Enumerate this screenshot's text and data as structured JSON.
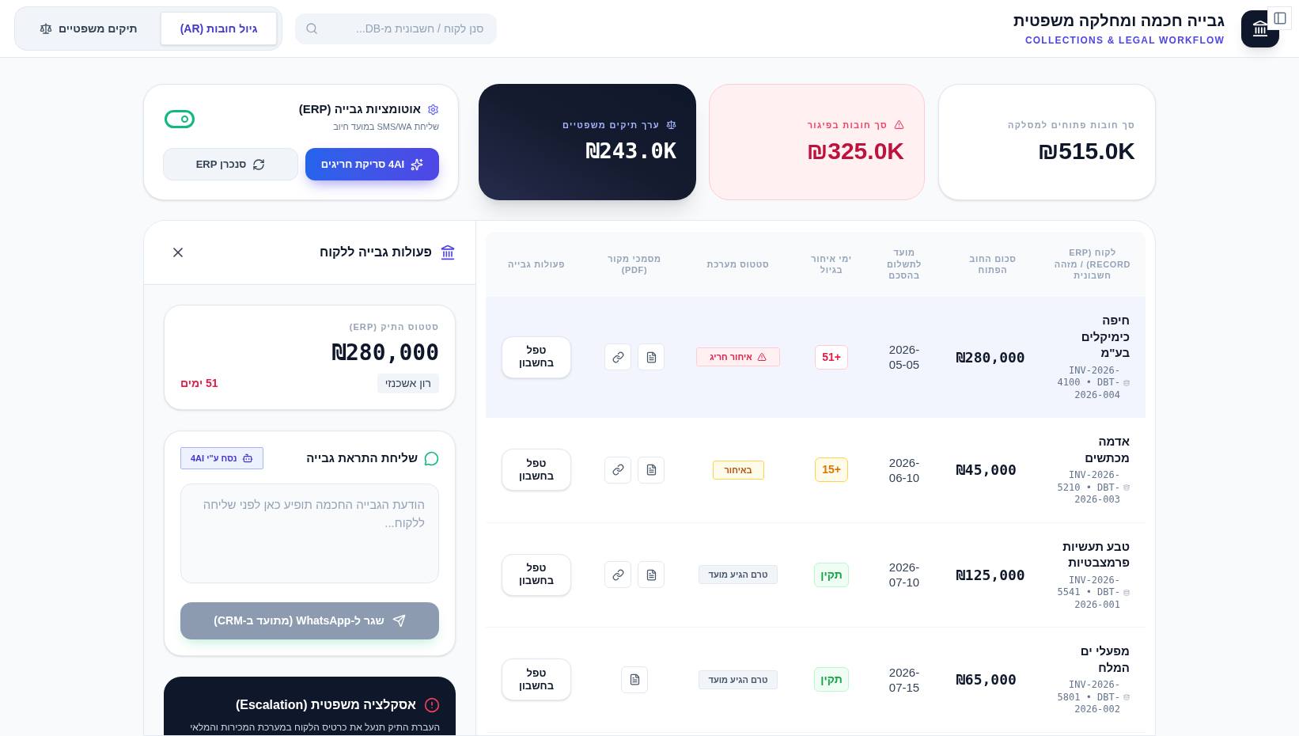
{
  "header": {
    "title": "גבייה חכמה ומחלקה משפטית",
    "subtitle": "COLLECTIONS & LEGAL WORKFLOW",
    "search": {
      "placeholder": "סנן לקוח / חשבונית מ-DB..."
    },
    "tabs": [
      {
        "label": "גיול חובות (AR)",
        "selected": true,
        "kind": "aging"
      },
      {
        "label": "תיקים משפטיים",
        "selected": false,
        "kind": "legal"
      }
    ]
  },
  "kpis": [
    {
      "label": "סך חובות פתוחים למסלקה",
      "value": "₪515.0K",
      "kind": "total"
    },
    {
      "label": "סך חובות בפיגור",
      "value": "₪325.0K",
      "kind": "overdue"
    },
    {
      "label": "ערך תיקים משפטיים",
      "value": "₪243.0K",
      "kind": "legal"
    }
  ],
  "automation": {
    "title": "אוטומציות גבייה (ERP)",
    "subtitle": "שליחת SMS/WA במועד חיוב",
    "on": true,
    "buttons": [
      {
        "label": "4AI סריקת חריגים",
        "kind": "scan"
      },
      {
        "label": "סנכרן ERP",
        "kind": "sync"
      }
    ]
  },
  "table": {
    "columns": [
      "לקוח (ERP RECORD) / מזהה חשבונית",
      "סכום החוב הפתוח",
      "מועד לתשלום בהסכם",
      "ימי איחור בגיול",
      "סטטוס מערכת",
      "מסמכי מקור (PDF)",
      "פעולות גבייה"
    ],
    "rows": [
      {
        "name": "חיפה כימיקלים בע\"מ",
        "ids": "INV-2026-4100 • DBT-2026-004",
        "amount": "₪280,000",
        "due": "2026-05-05",
        "aging": {
          "label": "+51",
          "kind": "critical"
        },
        "status": {
          "label": "איחור חריג",
          "kind": "critical"
        },
        "documents": [
          {
            "kind": "file"
          },
          {
            "kind": "link"
          }
        ],
        "action": "טפל בחשבון",
        "selected": true
      },
      {
        "name": "אדמה מכתשים",
        "ids": "INV-2026-5210 • DBT-2026-003",
        "amount": "₪45,000",
        "due": "2026-06-10",
        "aging": {
          "label": "+15",
          "kind": "warning"
        },
        "status": {
          "label": "באיחור",
          "kind": "warning"
        },
        "documents": [
          {
            "kind": "file"
          },
          {
            "kind": "link"
          }
        ],
        "action": "טפל בחשבון",
        "selected": false
      },
      {
        "name": "טבע תעשיות פרמצבטיות",
        "ids": "INV-2026-5541 • DBT-2026-001",
        "amount": "₪125,000",
        "due": "2026-07-10",
        "aging": {
          "label": "תקין",
          "kind": "ok"
        },
        "status": {
          "label": "טרם הגיע מועד",
          "kind": "pending"
        },
        "documents": [
          {
            "kind": "file"
          },
          {
            "kind": "link"
          }
        ],
        "action": "טפל בחשבון",
        "selected": false
      },
      {
        "name": "מפעלי ים המלח",
        "ids": "INV-2026-5801 • DBT-2026-002",
        "amount": "₪65,000",
        "due": "2026-07-15",
        "aging": {
          "label": "תקין",
          "kind": "ok"
        },
        "status": {
          "label": "טרם הגיע מועד",
          "kind": "pending"
        },
        "documents": [
          {
            "kind": "file"
          }
        ],
        "action": "טפל בחשבון",
        "selected": false
      }
    ]
  },
  "drawer": {
    "title": "פעולות גבייה ללקוח",
    "case": {
      "label": "סטטוס התיק (ERP)",
      "amount": "₪280,000",
      "owner": "רון אשכנזי",
      "overdue": "51 ימים"
    },
    "alert": {
      "title": "שליחת התראת גבייה",
      "badge": "נסח ע\"י 4AI",
      "message": {
        "placeholder": "הודעת הגבייה החכמה תופיע כאן לפני שליחה ללקוח..."
      },
      "send_button": {
        "label": "שגר ל-WhatsApp (מתועד ב-CRM)",
        "disabled": true
      }
    },
    "escalation": {
      "title": "אסקלציה משפטית (Escalation)",
      "text": "העברת התיק תנעל את כרטיס הלקוח במערכת המכירות והמלאי"
    }
  }
}
